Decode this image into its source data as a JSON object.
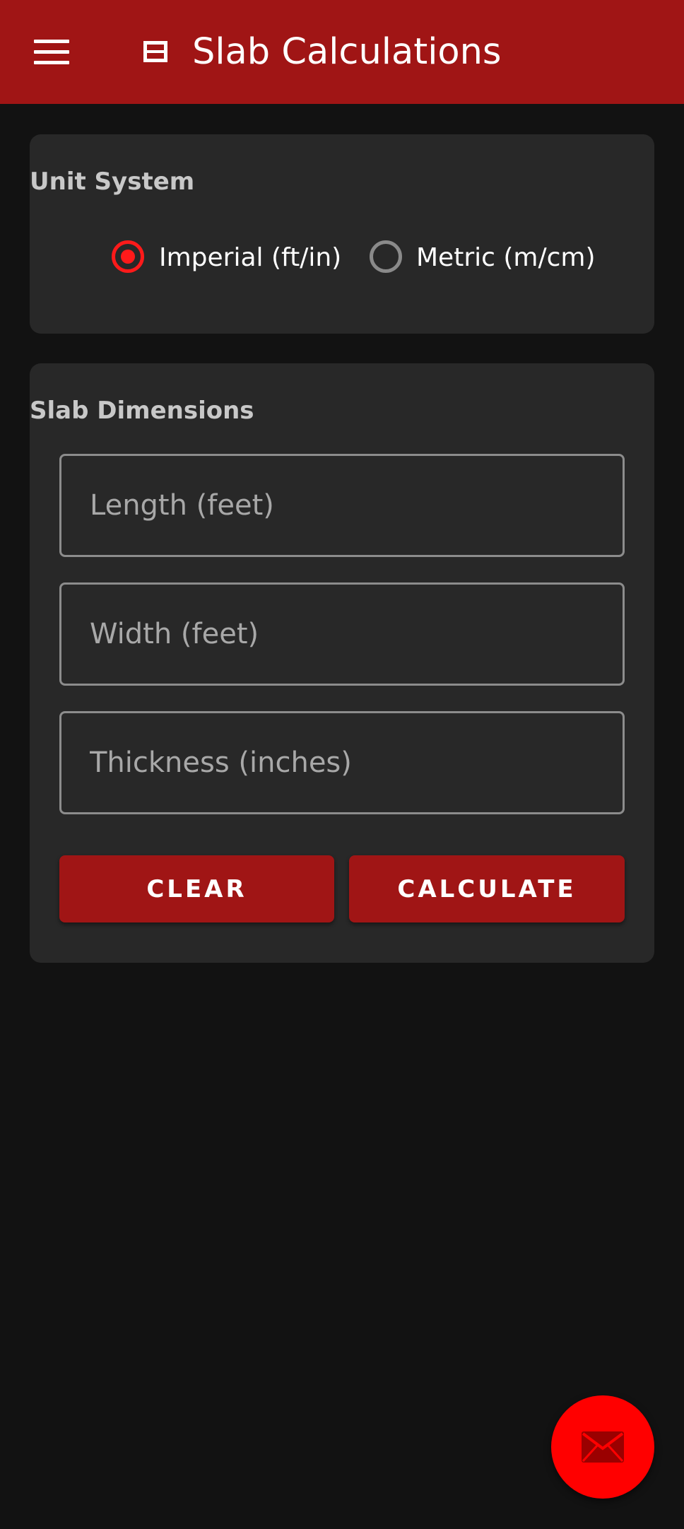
{
  "app_bar": {
    "title": "Slab Calculations",
    "menu_icon": "hamburger-menu-icon",
    "title_icon": "slab-icon",
    "color": "#a01515"
  },
  "unit_system": {
    "heading": "Unit System",
    "options": [
      {
        "label": "Imperial (ft/in)",
        "selected": true
      },
      {
        "label": "Metric (m/cm)",
        "selected": false
      }
    ]
  },
  "slab_dimensions": {
    "heading": "Slab Dimensions",
    "length": {
      "placeholder": "Length (feet)",
      "value": ""
    },
    "width": {
      "placeholder": "Width (feet)",
      "value": ""
    },
    "thickness": {
      "placeholder": "Thickness (inches)",
      "value": ""
    },
    "clear_label": "CLEAR",
    "calculate_label": "CALCULATE"
  },
  "fab": {
    "icon": "mail-icon",
    "color": "#ff0000"
  },
  "colors": {
    "background": "#121212",
    "card": "#282828",
    "accent": "#ff1a1a",
    "button": "#a01515"
  }
}
